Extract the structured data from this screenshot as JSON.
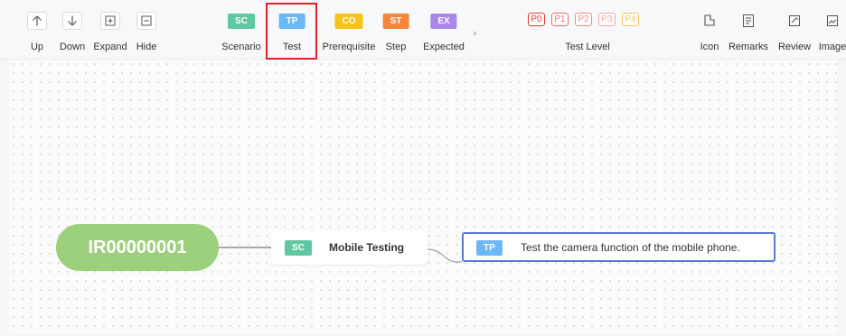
{
  "toolbar": {
    "up_label": "Up",
    "down_label": "Down",
    "expand_label": "Expand",
    "hide_label": "Hide",
    "tags": [
      {
        "text": "SC",
        "label": "Scenario",
        "color": "#5ec8a0"
      },
      {
        "text": "TP",
        "label": "Test",
        "color": "#6ab8f6"
      },
      {
        "text": "CO",
        "label": "Prerequisite",
        "color": "#f8c21a"
      },
      {
        "text": "ST",
        "label": "Step",
        "color": "#f7863d"
      },
      {
        "text": "EX",
        "label": "Expected",
        "color": "#a986e9"
      }
    ],
    "levels": [
      {
        "text": "P0",
        "color": "#e53935"
      },
      {
        "text": "P1",
        "color": "#ef6b6b"
      },
      {
        "text": "P2",
        "color": "#f08a8a"
      },
      {
        "text": "P3",
        "color": "#f2a7a7"
      },
      {
        "text": "P4",
        "color": "#f4c55a"
      }
    ],
    "level_label": "Test Level",
    "icon_label": "Icon",
    "remarks_label": "Remarks",
    "review_label": "Review",
    "image_label": "Image"
  },
  "map": {
    "root": "IR00000001",
    "scenario": {
      "tag": "SC",
      "title": "Mobile Testing"
    },
    "test": {
      "tag": "TP",
      "text": "Test the camera function of the mobile phone."
    }
  }
}
